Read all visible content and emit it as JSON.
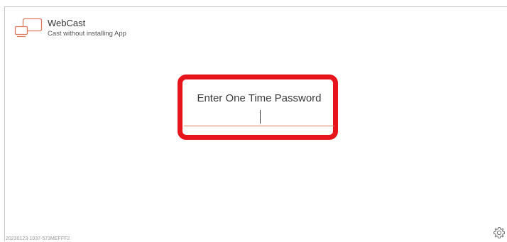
{
  "app": {
    "title": "WebCast",
    "subtitle": "Cast without installing App",
    "logo_icon": "cast-screens-icon",
    "accent_color": "#e07a5f"
  },
  "otp": {
    "label": "Enter One Time Password",
    "value": "",
    "highlight_color": "#e8141c"
  },
  "footer": {
    "version": "20230123-1037-573MEFFF2",
    "settings_icon": "gear-icon"
  }
}
